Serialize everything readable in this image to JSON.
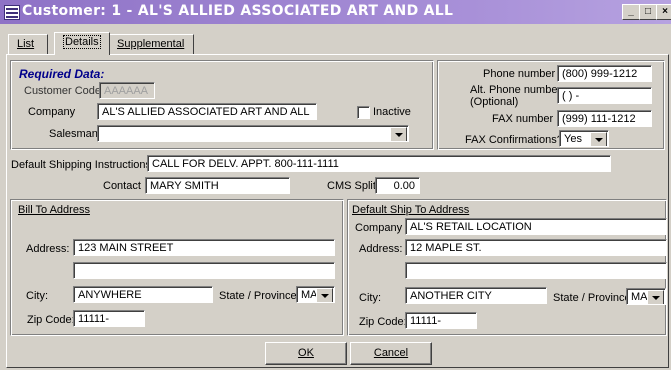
{
  "window": {
    "title": "Customer: 1 - AL'S ALLIED ASSOCIATED ART AND ALL",
    "minimize": "_",
    "maximize": "□",
    "close": "×"
  },
  "tabs": [
    {
      "label": "List"
    },
    {
      "label": "Details"
    },
    {
      "label": "Supplemental"
    }
  ],
  "required": {
    "header": "Required Data:",
    "customer_code_label": "Customer Code",
    "customer_code_value": "AAAAAA",
    "company_label": "Company",
    "company_value": "AL'S ALLIED ASSOCIATED ART AND ALL",
    "inactive_label": "Inactive",
    "salesman_label": "Salesman",
    "salesman_value": ""
  },
  "phones": {
    "phone_label": "Phone number",
    "phone_value": "(800) 999-1212",
    "alt_phone_label": "Alt. Phone number",
    "alt_phone_sub": "(Optional)",
    "alt_phone_value": "(   )    -",
    "fax_label": "FAX number",
    "fax_value": "(999) 111-1212",
    "fax_conf_label": "FAX Confirmations?",
    "fax_conf_value": "Yes"
  },
  "shipping": {
    "instructions_label": "Default Shipping Instructions",
    "instructions_value": "CALL FOR DELV. APPT. 800-111-1111",
    "contact_label": "Contact",
    "contact_value": "MARY SMITH",
    "cms_label": "CMS Split",
    "cms_value": "0.00"
  },
  "bill_to": {
    "title": "Bill To Address",
    "address_label": "Address:",
    "address1": "123 MAIN STREET",
    "address2": "",
    "city_label": "City:",
    "city_value": "ANYWHERE",
    "state_label": "State / Province:",
    "state_value": "MA",
    "zip_label": "Zip Code:",
    "zip_value": "11111-"
  },
  "ship_to": {
    "title": "Default Ship To Address",
    "company_label": "Company",
    "company_value": "AL'S RETAIL LOCATION",
    "address_label": "Address:",
    "address1": "12 MAPLE ST.",
    "address2": "",
    "city_label": "City:",
    "city_value": "ANOTHER CITY",
    "state_label": "State / Province:",
    "state_value": "MA",
    "zip_label": "Zip Code:",
    "zip_value": "11111-"
  },
  "buttons": {
    "ok": "OK",
    "cancel": "Cancel"
  }
}
